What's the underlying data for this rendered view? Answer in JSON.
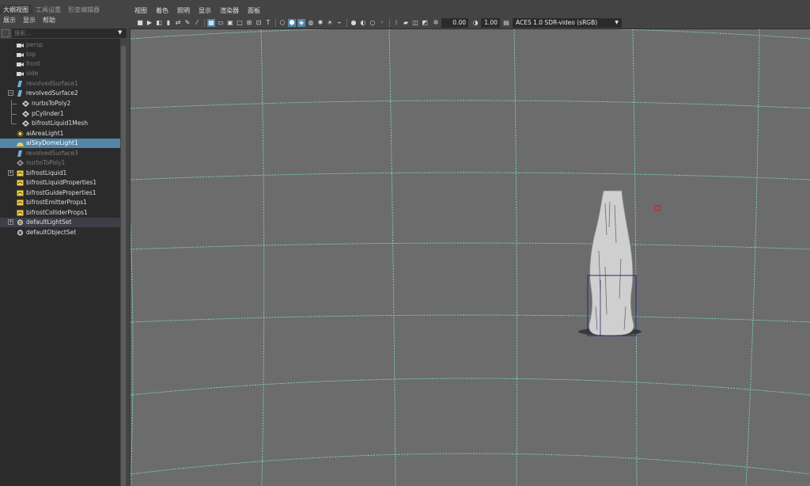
{
  "outliner": {
    "tabs": [
      "大纲视图",
      "工具设置",
      "形变编辑器"
    ],
    "menu": [
      "展示",
      "显示",
      "帮助"
    ],
    "search_placeholder": "搜索...",
    "items": [
      {
        "label": "persp",
        "icon": "camera-icon",
        "dim": true
      },
      {
        "label": "top",
        "icon": "camera-icon",
        "dim": true
      },
      {
        "label": "front",
        "icon": "camera-icon",
        "dim": true
      },
      {
        "label": "side",
        "icon": "camera-icon",
        "dim": true
      },
      {
        "label": "revolvedSurface1",
        "icon": "surface-icon",
        "dim": true
      },
      {
        "label": "revolvedSurface2",
        "icon": "surface-icon",
        "dim": false
      },
      {
        "label": "nurbsToPoly2",
        "icon": "poly-node-icon",
        "dim": false
      },
      {
        "label": "pCylinder1",
        "icon": "poly-node-icon",
        "dim": false
      },
      {
        "label": "bifrostLiquid1Mesh",
        "icon": "poly-node-icon",
        "dim": false
      },
      {
        "label": "aiAreaLight1",
        "icon": "area-light-icon",
        "dim": false
      },
      {
        "label": "aiSkyDomeLight1",
        "icon": "skydome-light-icon",
        "dim": false
      },
      {
        "label": "revolvedSurface3",
        "icon": "surface-icon",
        "dim": true
      },
      {
        "label": "nurbsToPoly1",
        "icon": "poly-node-icon",
        "dim": true
      },
      {
        "label": "bifrostLiquid1",
        "icon": "bifrost-icon",
        "dim": false
      },
      {
        "label": "bifrostLiquidProperties1",
        "icon": "bifrost-icon",
        "dim": false
      },
      {
        "label": "bifrostGuideProperties1",
        "icon": "bifrost-icon",
        "dim": false
      },
      {
        "label": "bifrostEmitterProps1",
        "icon": "bifrost-icon",
        "dim": false
      },
      {
        "label": "bifrostColliderProps1",
        "icon": "bifrost-icon",
        "dim": false
      },
      {
        "label": "defaultLightSet",
        "icon": "set-icon",
        "dim": false
      },
      {
        "label": "defaultObjectSet",
        "icon": "set-icon",
        "dim": false
      }
    ],
    "selected_item": "aiSkyDomeLight1"
  },
  "viewport": {
    "menu": [
      "视图",
      "着色",
      "照明",
      "显示",
      "渲染器",
      "面板"
    ],
    "exposure_value": "0.00",
    "gamma_value": "1.00",
    "color_space": "ACES 1.0 SDR-video (sRGB)",
    "colors": {
      "background": "#6c6c6c",
      "grid": "#7fd9c8",
      "bounding_box": "#262680",
      "light_marker": "#d62020",
      "selection": "#5285a6"
    }
  }
}
